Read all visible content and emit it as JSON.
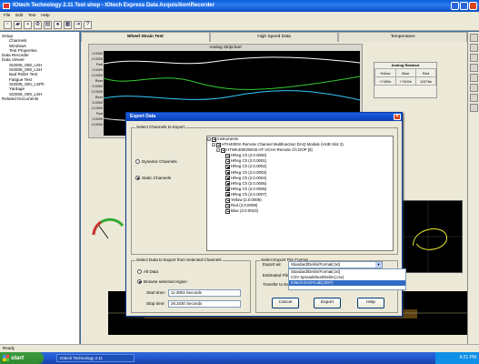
{
  "window": {
    "title": "IOtech Technology 2.11 Test shop - IOtech Express Data Acquisition\\Recorder"
  },
  "menu": [
    "File",
    "Edit",
    "Test",
    "Help"
  ],
  "tabs": [
    "Wheel Strain Test",
    "High Speed Data",
    "Temperature"
  ],
  "tree": [
    "Setup",
    "Channels",
    "Windows",
    "Test Properties",
    "Data Recorder",
    "Data Viewer",
    "St2005_008_LSH",
    "St2005_009_LSH",
    "Bad Roller Test",
    "Fatigue Test",
    "St2005_000_LSPh",
    "Yardage",
    "St2005_009_LSH",
    "Related Documents"
  ],
  "strain": {
    "title": "Analog Stripchart",
    "axis_labels": [
      "0.0000",
      "-0.0000",
      "Fwd",
      "0.0000",
      "-0.0000",
      "Rear",
      "0.0000",
      "-0.0000",
      "Rear",
      "0.0000",
      "-0.0000",
      "Fwd",
      "0.0000",
      "-0.0000"
    ]
  },
  "readout": {
    "title": "Analog Readout",
    "headers": [
      "Yellow",
      "Blue",
      "Red"
    ],
    "values": [
      "+7400e",
      "+7400e",
      "11578e"
    ]
  },
  "dialog": {
    "title": "Export Data",
    "channels_group": "Select Channels to Export",
    "radio_dynamic": "Dynamic Channels",
    "radio_static": "Static Channels",
    "tree": [
      "Instruments",
      "HTH4000A Remote Channel Multifunction DAQ Module (HUB Slot 3)",
      "HTWK4000/WCB HT-VCHA Remote Ch DOP [0]",
      "HReg Ch (2.0.0000)",
      "HReg Ch (2.0.0001)",
      "HReg Ch (2.0.0002)",
      "HReg Ch (2.0.0003)",
      "HReg Ch (2.0.0004)",
      "HReg Ch (2.0.0005)",
      "HReg Ch (2.0.0006)",
      "HReg Ch (2.0.0007)",
      "Yellow (2.0.0008)",
      "Red (2.0.0009)",
      "Blue (2.0.0010)"
    ],
    "range_group": "Select Data to Export from Selected Channels",
    "radio_all": "All Data",
    "radio_browse": "Browse selected region",
    "start_label": "Start time:",
    "start_value": "11.3903 Seconds",
    "stop_label": "Stop time:",
    "stop_value": "26.3430 Seconds",
    "format_group": "Select Export File Format",
    "export_as_label": "Export as:",
    "export_as_value": "Standard/Delim/Format(.txt)",
    "estimated_label": "Estimated File",
    "transfer_label": "Transfer to Exc",
    "formats": [
      "Standard/Delim/Format(.txt)",
      "CSV Spreadsheet/Delim(.csv)",
      "IOtech DASYLab(.DDF)"
    ],
    "cancel": "Cancel",
    "export": "Export",
    "help": "Help"
  },
  "status": "Ready",
  "taskbar": {
    "start": "start",
    "item": "IOtech Technology 2.11",
    "clock": "4:21 PM"
  }
}
